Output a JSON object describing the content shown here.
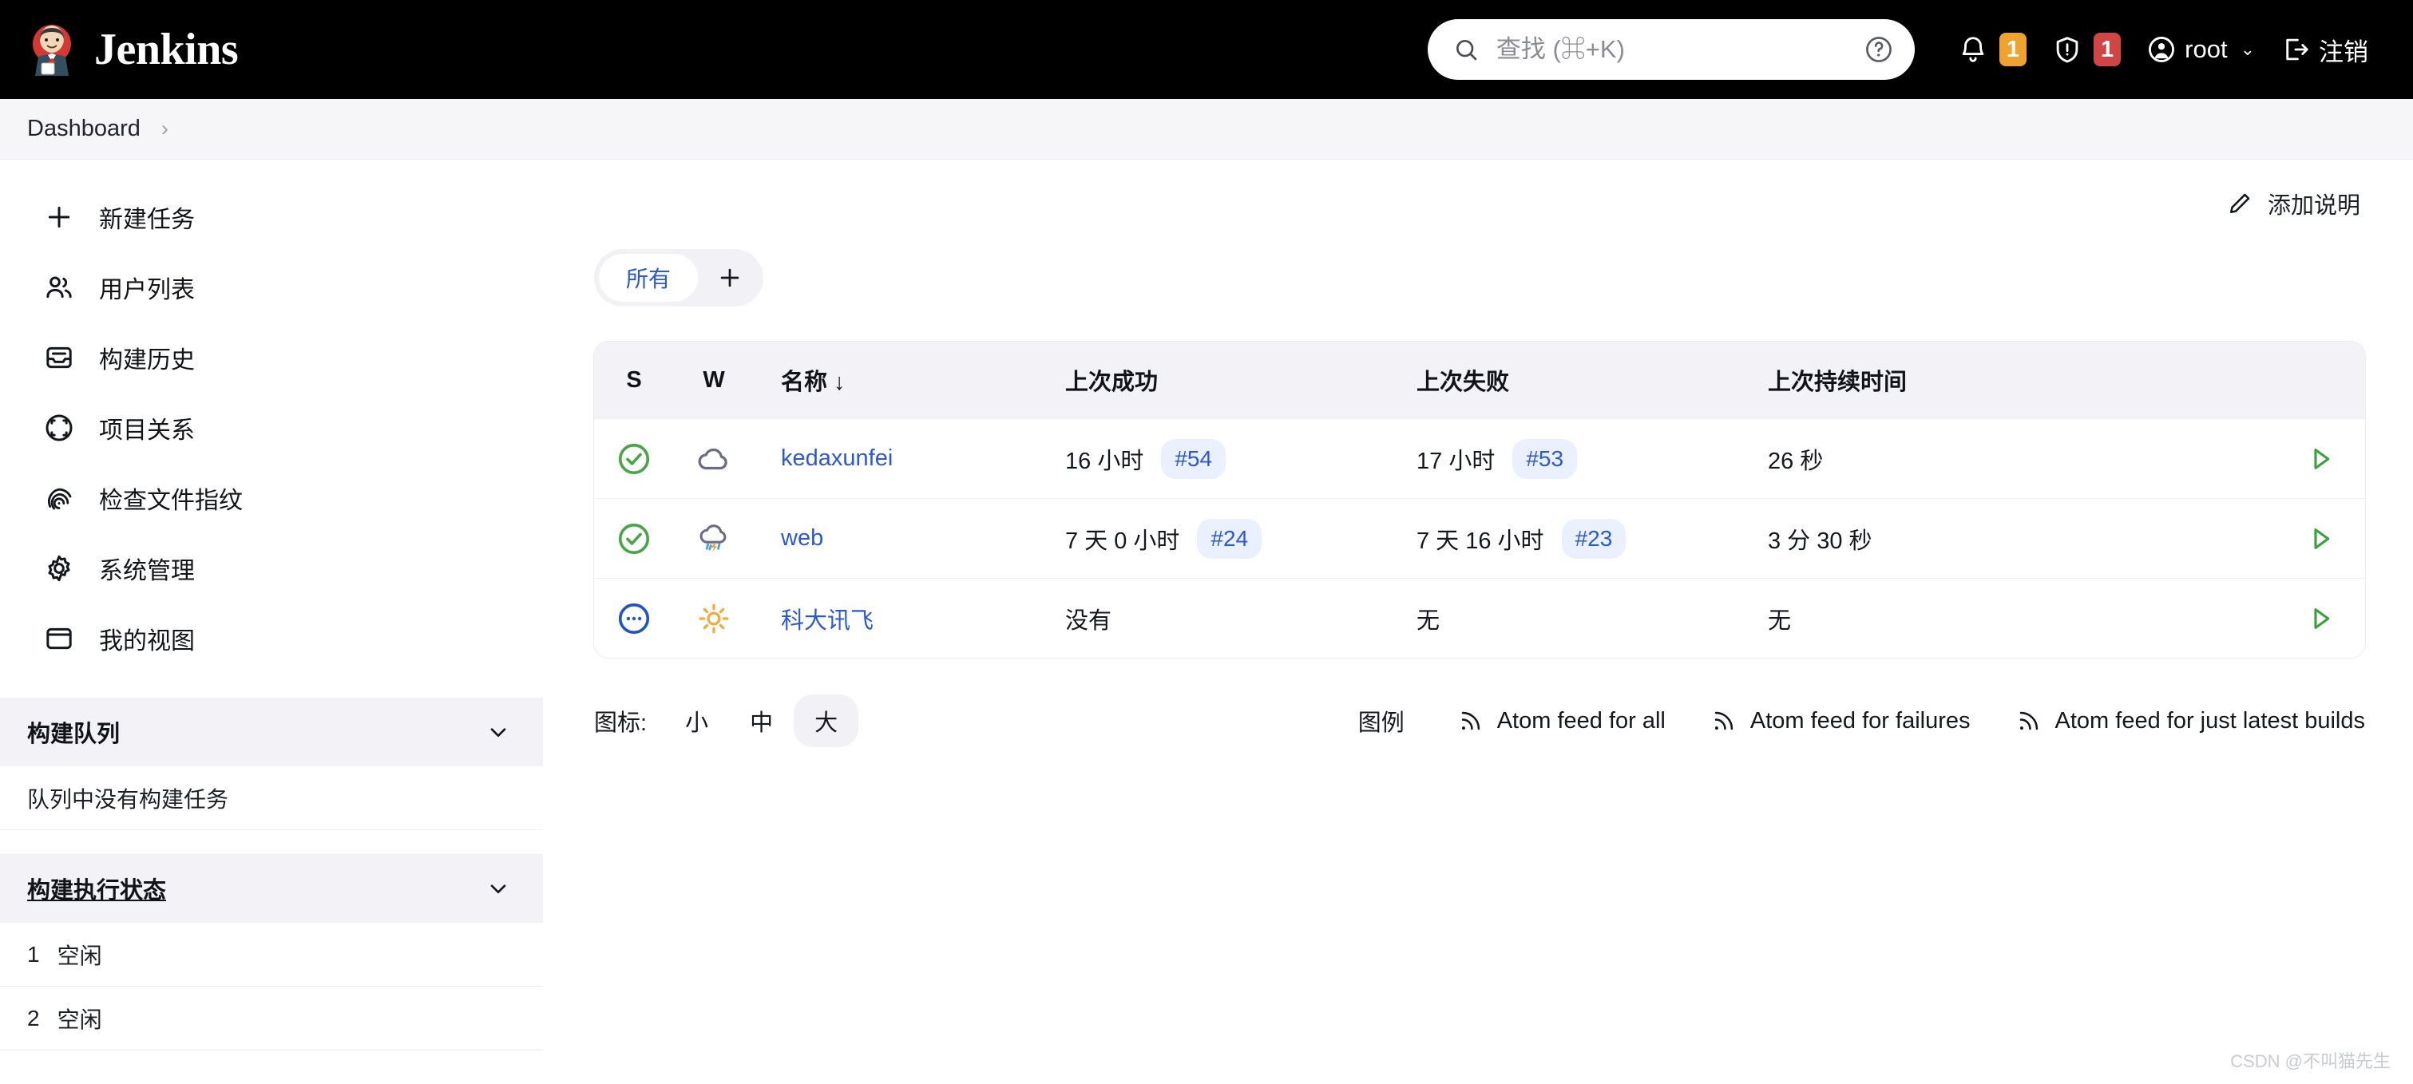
{
  "header": {
    "brand_title": "Jenkins",
    "brand_logo_icon": "jenkins-butler-logo",
    "search": {
      "placeholder": "查找 (⌘+K)",
      "value": "",
      "search_icon": "search-icon",
      "help_icon": "help-circle-icon"
    },
    "notifications": {
      "icon": "bell-icon",
      "count": "1",
      "color": "#f0a22e"
    },
    "security": {
      "icon": "shield-alert-icon",
      "count": "1",
      "color": "#d14545"
    },
    "user": {
      "icon": "user-circle-icon",
      "name": "root",
      "chevron": "chevron-down-icon"
    },
    "logout": {
      "icon": "logout-icon",
      "label": "注销"
    }
  },
  "breadcrumb": {
    "items": [
      "Dashboard"
    ],
    "separator": "›"
  },
  "sidebar": {
    "items": [
      {
        "label": "新建任务",
        "icon": "plus-icon"
      },
      {
        "label": "用户列表",
        "icon": "users-icon"
      },
      {
        "label": "构建历史",
        "icon": "inbox-icon"
      },
      {
        "label": "项目关系",
        "icon": "relations-icon"
      },
      {
        "label": "检查文件指纹",
        "icon": "fingerprint-icon"
      },
      {
        "label": "系统管理",
        "icon": "gear-icon"
      },
      {
        "label": "我的视图",
        "icon": "window-icon"
      }
    ],
    "build_queue": {
      "title": "构建队列",
      "collapse_icon": "chevron-down-icon",
      "empty_text": "队列中没有构建任务"
    },
    "build_executor": {
      "title": "构建执行状态",
      "collapse_icon": "chevron-down-icon",
      "executors": [
        {
          "num": "1",
          "status": "空闲"
        },
        {
          "num": "2",
          "status": "空闲"
        }
      ]
    }
  },
  "main": {
    "add_description": {
      "label": "添加说明",
      "icon": "pencil-icon"
    },
    "tabs": {
      "all_label": "所有",
      "add_icon": "plus-icon"
    },
    "table": {
      "columns": [
        "S",
        "W",
        "名称 ↓",
        "上次成功",
        "上次失败",
        "上次持续时间"
      ],
      "rows": [
        {
          "status_icon": "check-circle-icon",
          "status_color": "#49a548",
          "weather_icon": "cloud-icon",
          "name": "kedaxunfei",
          "last_success": "16 小时",
          "last_success_build": "#54",
          "last_failure": "17 小时",
          "last_failure_build": "#53",
          "duration": "26 秒",
          "run_icon": "play-icon"
        },
        {
          "status_icon": "check-circle-icon",
          "status_color": "#49a548",
          "weather_icon": "storm-cloud-icon",
          "name": "web",
          "last_success": "7 天 0 小时",
          "last_success_build": "#24",
          "last_failure": "7 天 16 小时",
          "last_failure_build": "#23",
          "duration": "3 分 30 秒",
          "run_icon": "play-icon"
        },
        {
          "status_icon": "pending-dots-circle-icon",
          "status_color": "#2255c4",
          "weather_icon": "sun-icon",
          "name": "科大讯飞",
          "last_success": "没有",
          "last_success_build": "",
          "last_failure": "无",
          "last_failure_build": "",
          "duration": "无",
          "run_icon": "play-icon"
        }
      ]
    },
    "footer": {
      "icon_size_label": "图标:",
      "sizes": [
        {
          "label": "小",
          "active": false
        },
        {
          "label": "中",
          "active": false
        },
        {
          "label": "大",
          "active": true
        }
      ],
      "legend_label": "图例",
      "feeds": [
        {
          "label": "Atom feed for all",
          "icon": "rss-icon"
        },
        {
          "label": "Atom feed for failures",
          "icon": "rss-icon"
        },
        {
          "label": "Atom feed for just latest builds",
          "icon": "rss-icon"
        }
      ]
    }
  },
  "watermark": "CSDN @不叫猫先生"
}
